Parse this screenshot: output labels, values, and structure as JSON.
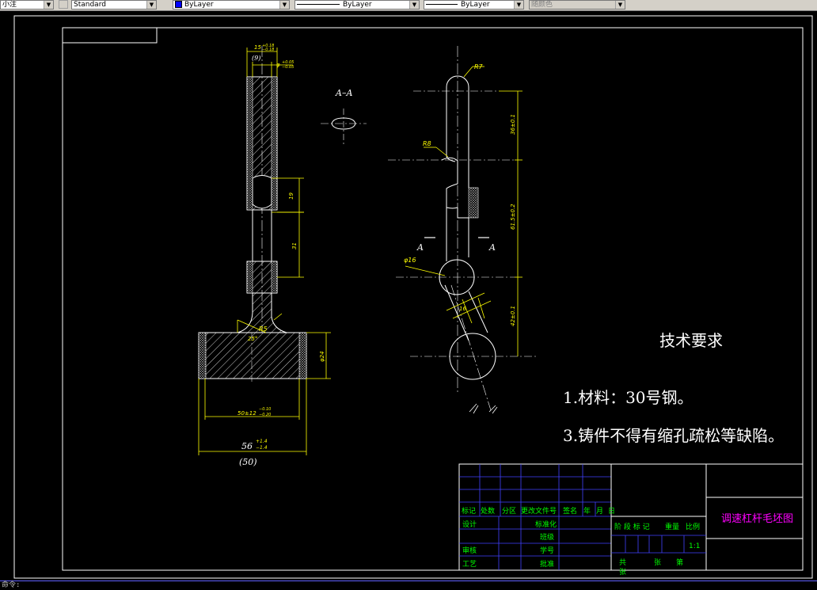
{
  "toolbar": {
    "dimstyle": "小注",
    "textstyle": "Standard",
    "layer_color": "ByLayer",
    "linetype": "ByLayer",
    "lineweight": "ByLayer",
    "plotstyle": "随颜色"
  },
  "drawing": {
    "section_label": "A–A",
    "cut_a_left": "A",
    "cut_a_right": "A",
    "tech_title": "技术要求",
    "tech_note_1": "1.材料：30号钢。",
    "tech_note_2": "3.铸件不得有缩孔疏松等缺陷。",
    "dims": {
      "top_width": "15",
      "top_tol_upper": "+0.18",
      "top_tol_lower": "−0.18",
      "top_paren": "(9)",
      "top_d": "φ",
      "top_d_upper": "+0.05",
      "top_d_lower": "−0.05",
      "d19": "19",
      "d31": "31",
      "r5": "R5",
      "angle": "25°",
      "d24": "φ24",
      "d50": "50±12",
      "d50_upper": "−0.10",
      "d50_lower": "−0.20",
      "d56": "56",
      "d56_upper": "+1.4",
      "d56_lower": "−1.4",
      "d50_paren": "(50)",
      "r7": "R7",
      "r8": "R8",
      "phi16": "φ16",
      "d36": "36±0.1",
      "d615": "61.5±0.2",
      "d42": "42±0.1",
      "d16": "16"
    }
  },
  "title_block": {
    "headers": [
      "标记",
      "处数",
      "分区",
      "更改文件号",
      "签名",
      "年",
      "月",
      "日"
    ],
    "design": "设计",
    "standardize": "标准化",
    "class": "班级",
    "review": "审核",
    "student_id": "学号",
    "process": "工艺",
    "approve": "批准",
    "stage_mark": "阶 段 标 记",
    "weight": "重量",
    "scale": "比例",
    "scale_value": "1:1",
    "total": "共",
    "sheet": "张",
    "page": "第",
    "page_unit": "张",
    "drawing_name": "调速杠杆毛坯图"
  },
  "command_line": "命令:"
}
